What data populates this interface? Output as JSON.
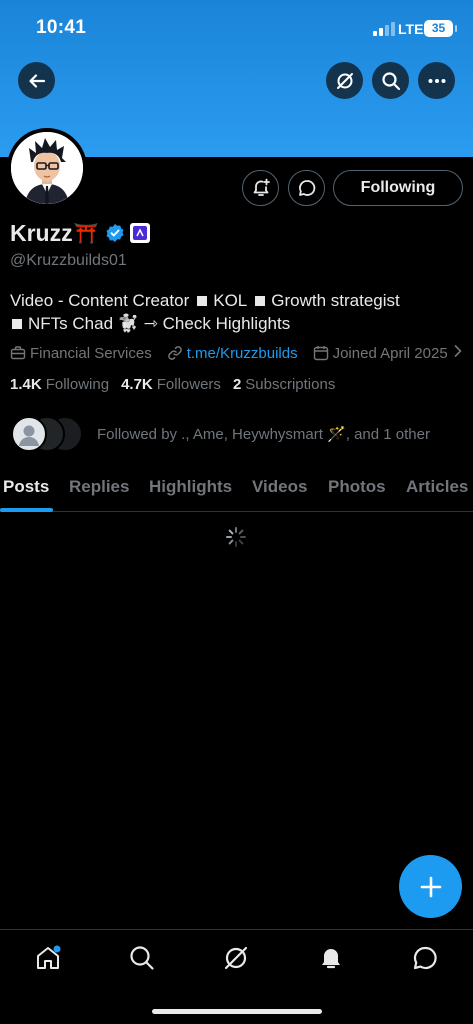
{
  "status_bar": {
    "time": "10:41",
    "network": "LTE",
    "battery": "35"
  },
  "profile": {
    "name": "Kruzz",
    "name_emoji": "⛩️",
    "handle": "@Kruzzbuilds01",
    "bio_line1_a": "Video - Content Creator",
    "bio_line1_b": "KOL",
    "bio_line1_c": "Growth strategist",
    "bio_line2_a": "NFTs Chad",
    "bio_line2_emoji": "🐩",
    "bio_line2_b": "Check Highlights",
    "category": "Financial Services",
    "link": "t.me/Kruzzbuilds",
    "joined": "Joined April 2025",
    "following_count": "1.4K",
    "following_label": "Following",
    "followers_count": "4.7K",
    "followers_label": "Followers",
    "subscriptions_count": "2",
    "subscriptions_label": "Subscriptions",
    "followed_by": "Followed by ., Ame, Heywhysmart 🪄, and 1 other"
  },
  "actions": {
    "following_button": "Following"
  },
  "tabs": [
    {
      "label": "Posts",
      "active": true
    },
    {
      "label": "Replies"
    },
    {
      "label": "Highlights"
    },
    {
      "label": "Videos"
    },
    {
      "label": "Photos"
    },
    {
      "label": "Articles"
    }
  ],
  "icons": {
    "back": "arrow-left-icon",
    "grok": "grok-icon",
    "search": "search-icon",
    "more": "more-icon",
    "subscribe_notifications": "bell-plus-icon",
    "message": "message-icon",
    "verified": "verified-badge-icon",
    "affiliate": "affiliate-badge-icon",
    "compose": "plus-icon",
    "nav_home": "home-icon",
    "nav_search": "search-icon",
    "nav_grok": "grok-icon",
    "nav_notifications": "bell-icon",
    "nav_messages": "message-icon"
  },
  "colors": {
    "accent": "#1d9bf0",
    "banner": "#2b9cf0",
    "background": "#000000"
  }
}
